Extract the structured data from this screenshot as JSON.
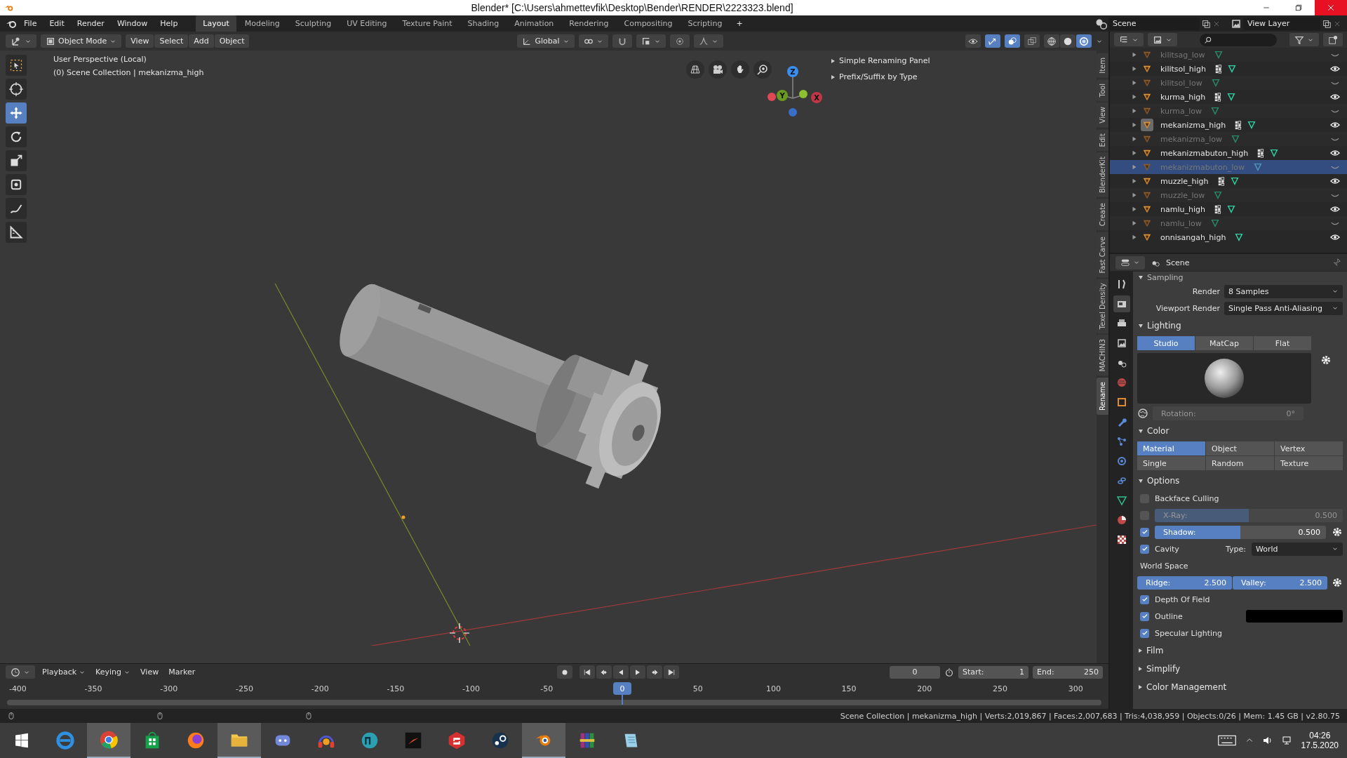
{
  "window": {
    "title": "Blender* [C:\\Users\\ahmettevfik\\Desktop\\Bender\\RENDER\\2223323.blend]"
  },
  "menu": [
    "File",
    "Edit",
    "Render",
    "Window",
    "Help"
  ],
  "workspaces": [
    {
      "label": "Layout",
      "selected": true
    },
    {
      "label": "Modeling",
      "selected": false
    },
    {
      "label": "Sculpting",
      "selected": false
    },
    {
      "label": "UV Editing",
      "selected": false
    },
    {
      "label": "Texture Paint",
      "selected": false
    },
    {
      "label": "Shading",
      "selected": false
    },
    {
      "label": "Animation",
      "selected": false
    },
    {
      "label": "Rendering",
      "selected": false
    },
    {
      "label": "Compositing",
      "selected": false
    },
    {
      "label": "Scripting",
      "selected": false
    }
  ],
  "add_workspace": "+",
  "scene": {
    "scene": "Scene",
    "view_layer": "View Layer"
  },
  "viewport": {
    "mode": "Object Mode",
    "menus": [
      "View",
      "Select",
      "Add",
      "Object"
    ],
    "orientation": "Global",
    "snap": false,
    "proportional": false,
    "toggles": [
      {
        "kind": "visibility",
        "on": false
      },
      {
        "kind": "gizmo",
        "on": true
      },
      {
        "kind": "overlay",
        "on": true
      },
      {
        "kind": "xray",
        "on": false
      }
    ],
    "shading": [
      {
        "kind": "wireframe",
        "selected": false
      },
      {
        "kind": "solid",
        "selected": false
      },
      {
        "kind": "lookdev",
        "selected": true
      }
    ],
    "title": "User Perspective (Local)",
    "subtitle": "(0) Scene Collection | mekanizma_high",
    "tools": [
      {
        "kind": "select",
        "selected": false
      },
      {
        "kind": "cursor",
        "selected": false
      },
      {
        "kind": "move",
        "selected": true
      },
      {
        "kind": "rotate",
        "selected": false
      },
      {
        "kind": "scale",
        "selected": false
      },
      {
        "kind": "transform",
        "selected": false
      },
      {
        "kind": "annotate",
        "selected": false
      },
      {
        "kind": "measure",
        "selected": false
      }
    ],
    "axes": [
      {
        "label": "Z"
      },
      {
        "label": "Y"
      },
      {
        "label": "X"
      }
    ],
    "panels": [
      "Simple Renaming Panel",
      "Prefix/Suffix by Type"
    ],
    "sidebar_tabs": [
      {
        "label": "Item",
        "selected": false
      },
      {
        "label": "Tool",
        "selected": false
      },
      {
        "label": "View",
        "selected": false
      },
      {
        "label": "Edit",
        "selected": false
      },
      {
        "label": "BlenderKit",
        "selected": false
      },
      {
        "label": "Create",
        "selected": false
      },
      {
        "label": "Fast Carve",
        "selected": false
      },
      {
        "label": "Texel Density",
        "selected": false
      },
      {
        "label": "MACHIN3",
        "selected": false
      },
      {
        "label": "Rename",
        "selected": true
      }
    ]
  },
  "outliner": {
    "rows": [
      {
        "name": "kilitsag_low",
        "visible": false,
        "modifiers": false,
        "selected": false,
        "active": false
      },
      {
        "name": "kilitsol_high",
        "visible": true,
        "modifiers": true,
        "selected": false,
        "active": false
      },
      {
        "name": "kilitsol_low",
        "visible": false,
        "modifiers": false,
        "selected": false,
        "active": false
      },
      {
        "name": "kurma_high",
        "visible": true,
        "modifiers": true,
        "selected": false,
        "active": false
      },
      {
        "name": "kurma_low",
        "visible": false,
        "modifiers": false,
        "selected": false,
        "active": false
      },
      {
        "name": "mekanizma_high",
        "visible": true,
        "modifiers": true,
        "selected": false,
        "active": true
      },
      {
        "name": "mekanizma_low",
        "visible": false,
        "modifiers": false,
        "selected": false,
        "active": false
      },
      {
        "name": "mekanizmabuton_high",
        "visible": true,
        "modifiers": true,
        "selected": false,
        "active": false
      },
      {
        "name": "mekanizmabuton_low",
        "visible": false,
        "modifiers": false,
        "selected": true,
        "active": false
      },
      {
        "name": "muzzle_high",
        "visible": true,
        "modifiers": true,
        "selected": false,
        "active": false
      },
      {
        "name": "muzzle_low",
        "visible": false,
        "modifiers": false,
        "selected": false,
        "active": false
      },
      {
        "name": "namlu_high",
        "visible": true,
        "modifiers": true,
        "selected": false,
        "active": false
      },
      {
        "name": "namlu_low",
        "visible": false,
        "modifiers": false,
        "selected": false,
        "active": false
      },
      {
        "name": "onnisangah_high",
        "visible": true,
        "modifiers": false,
        "selected": false,
        "active": false
      }
    ]
  },
  "properties": {
    "title": "Scene",
    "tabs": [
      {
        "kind": "tool",
        "selected": false
      },
      {
        "kind": "render",
        "selected": true
      },
      {
        "kind": "output",
        "selected": false
      },
      {
        "kind": "view_layer",
        "selected": false
      },
      {
        "kind": "scene",
        "selected": false
      },
      {
        "kind": "world",
        "selected": false
      },
      {
        "kind": "object",
        "selected": false
      },
      {
        "kind": "modifiers",
        "selected": false
      },
      {
        "kind": "particles",
        "selected": false
      },
      {
        "kind": "physics",
        "selected": false
      },
      {
        "kind": "constraints",
        "selected": false
      },
      {
        "kind": "data",
        "selected": false
      },
      {
        "kind": "material",
        "selected": false
      },
      {
        "kind": "texture",
        "selected": false
      }
    ],
    "sampling": {
      "title": "Sampling",
      "rows": [
        {
          "label": "Render",
          "value": "8 Samples"
        },
        {
          "label": "Viewport Render",
          "value": "Single Pass Anti-Aliasing"
        }
      ]
    },
    "lighting": {
      "title": "Lighting",
      "options": [
        {
          "label": "Studio",
          "selected": true
        },
        {
          "label": "MatCap",
          "selected": false
        },
        {
          "label": "Flat",
          "selected": false
        }
      ],
      "rotation_label": "Rotation:",
      "rotation": "0°"
    },
    "color": {
      "title": "Color",
      "options": [
        {
          "label": "Material",
          "selected": true
        },
        {
          "label": "Object",
          "selected": false
        },
        {
          "label": "Vertex",
          "selected": false
        },
        {
          "label": "Single",
          "selected": false
        },
        {
          "label": "Random",
          "selected": false
        },
        {
          "label": "Texture",
          "selected": false
        }
      ]
    },
    "options": {
      "title": "Options",
      "backface": {
        "label": "Backface Culling",
        "checked": false
      },
      "xray": {
        "label": "X-Ray:",
        "checked": false,
        "level": 0.5,
        "value": "0.500"
      },
      "shadow": {
        "label": "Shadow:",
        "checked": true,
        "level": 0.5,
        "value": "0.500"
      },
      "cavity": {
        "label": "Cavity",
        "checked": true,
        "type_label": "Type:",
        "type": "World"
      },
      "space": "World Space",
      "ridge": {
        "label": "Ridge:",
        "value": "2.500",
        "level": 1
      },
      "valley": {
        "label": "Valley:",
        "value": "2.500",
        "level": 1
      },
      "dof": {
        "label": "Depth Of Field",
        "checked": true
      },
      "outline": {
        "label": "Outline",
        "checked": true
      },
      "specular": {
        "label": "Specular Lighting",
        "checked": true
      }
    },
    "collapsed": [
      "Film",
      "Simplify",
      "Color Management"
    ]
  },
  "timeline": {
    "menus": [
      "Playback",
      "Keying",
      "View",
      "Marker"
    ],
    "frame": "0",
    "start_label": "Start:",
    "start": "1",
    "end_label": "End:",
    "end": "250",
    "current": "0",
    "ticks": [
      "-400",
      "-350",
      "-300",
      "-250",
      "-200",
      "-150",
      "-100",
      "-50",
      "50",
      "100",
      "150",
      "200",
      "250",
      "300"
    ]
  },
  "status_bar": "Scene Collection | mekanizma_high | Verts:2,019,867 | Faces:2,007,683 | Tris:4,038,959 | Objects:0/26 | Mem: 1.45 GB | v2.80.75",
  "taskbar": {
    "apps": [
      {
        "kind": "ie",
        "selected": false
      },
      {
        "kind": "chrome",
        "selected": true
      },
      {
        "kind": "store",
        "selected": false
      },
      {
        "kind": "firefox",
        "selected": false
      },
      {
        "kind": "explorer",
        "selected": true
      },
      {
        "kind": "discord",
        "selected": false
      },
      {
        "kind": "headphones",
        "selected": false
      },
      {
        "kind": "globe",
        "selected": false
      },
      {
        "kind": "arrow",
        "selected": false
      },
      {
        "kind": "sketch",
        "selected": false
      },
      {
        "kind": "steam",
        "selected": false
      },
      {
        "kind": "blender",
        "selected": true
      },
      {
        "kind": "archive",
        "selected": false
      },
      {
        "kind": "notes",
        "selected": false
      }
    ],
    "time": "04:26",
    "date": "17.5.2020"
  }
}
